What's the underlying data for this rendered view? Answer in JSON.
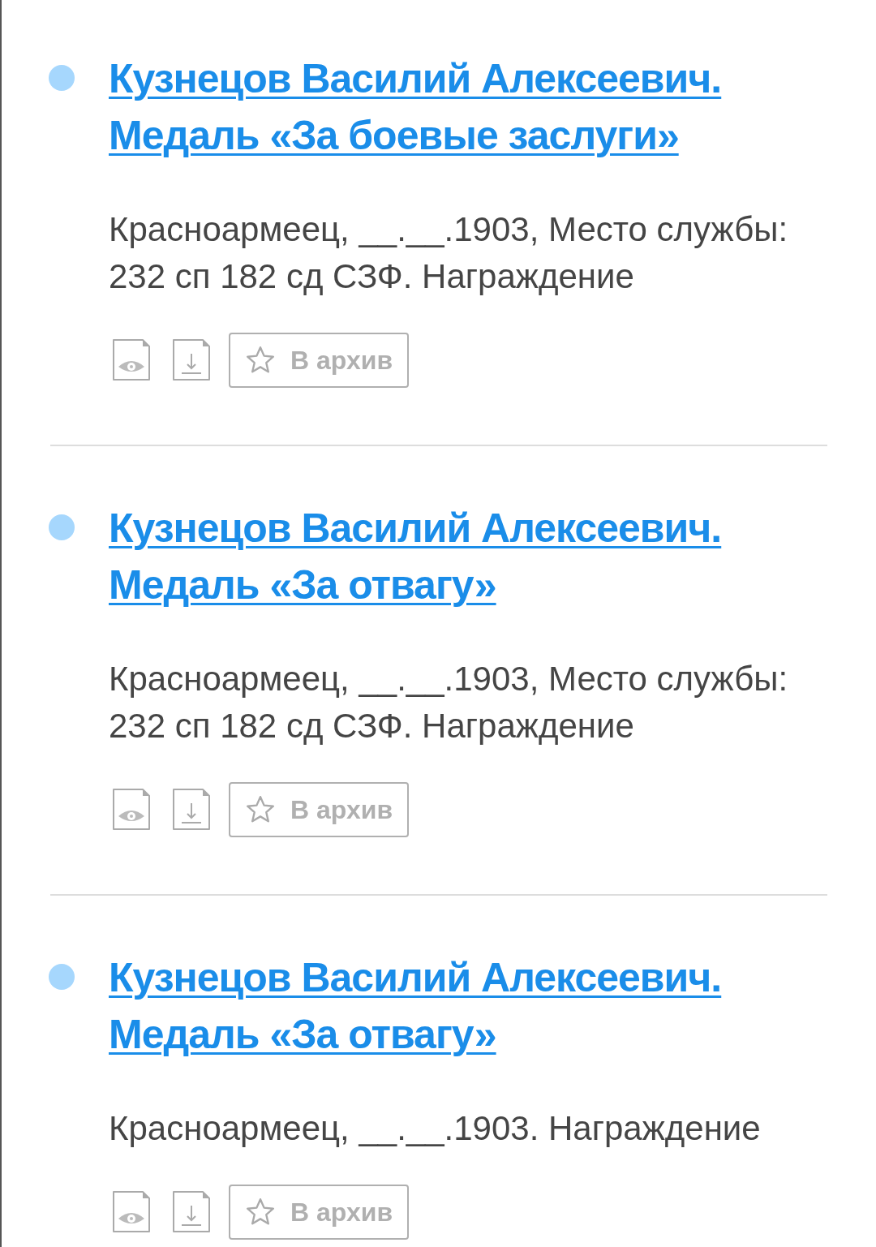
{
  "results": [
    {
      "title": "Кузнецов Василий Алексеевич. Медаль «За боевые заслуги»",
      "description": "Красноармеец, __.__.1903, Место службы: 232 сп 182 сд СЗФ. Награждение",
      "archive_button": "В архив"
    },
    {
      "title": "Кузнецов Василий Алексеевич. Медаль «За отвагу»",
      "description": "Красноармеец, __.__.1903, Место службы: 232 сп 182 сд СЗФ. Награждение",
      "archive_button": "В архив"
    },
    {
      "title": "Кузнецов Василий Алексеевич. Медаль «За отвагу»",
      "description": "Красноармеец, __.__.1903. Награждение",
      "archive_button": "В архив"
    }
  ]
}
